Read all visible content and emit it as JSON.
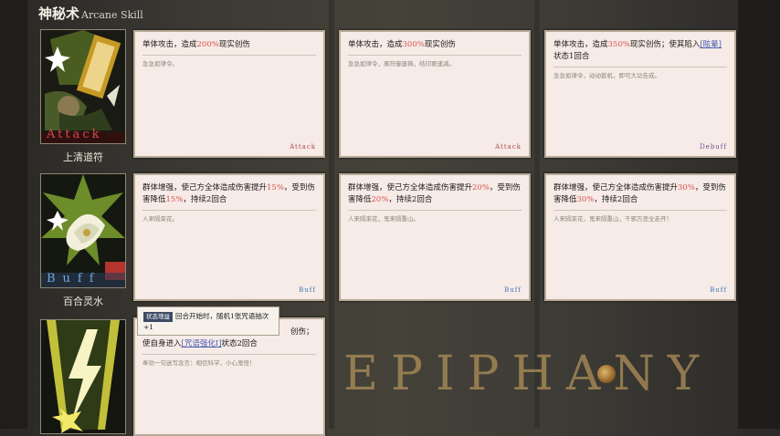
{
  "header": {
    "title_zh": "神秘术",
    "title_en": "Arcane Skill"
  },
  "background": {
    "logo_text": "EPIPHANY"
  },
  "skills": [
    {
      "name": "上清道符",
      "art_label": "Attack",
      "art_icon": "talisman-icon",
      "cards": [
        {
          "title_pre": "单体攻击，造成",
          "value": "200%",
          "title_post": "现实创伤",
          "flavor": "急急如律令。",
          "tag": "Attack"
        },
        {
          "title_pre": "单体攻击，造成",
          "value": "300%",
          "title_post": "现实创伤",
          "flavor": "急急如律令，离符御速祷，结印要速减。",
          "tag": "Attack"
        },
        {
          "title_pre": "单体攻击，造成",
          "value": "350%",
          "title_post": "现实创伤；使其陷入",
          "link": "[眩晕]",
          "title_tail": "状态1回合",
          "flavor": "急急如律令，动动扳机，即可大功告成。",
          "tag": "Debuff"
        }
      ]
    },
    {
      "name": "百合灵水",
      "art_label": "Buff",
      "art_icon": "lily-icon",
      "cards": [
        {
          "title_pre": "群体增强，使己方全体造成伤害提升",
          "value": "15%",
          "title_mid": "，受到伤害降低",
          "value2": "15%",
          "title_post": "，持续2回合",
          "flavor": "人来隔束花。",
          "tag": "Buff"
        },
        {
          "title_pre": "群体增强，使己方全体造成伤害提升",
          "value": "20%",
          "title_mid": "，受到伤害降低",
          "value2": "20%",
          "title_post": "，持续2回合",
          "flavor": "人来隔束花，鬼来隔重山。",
          "tag": "Buff"
        },
        {
          "title_pre": "群体增强，使己方全体造成伤害提升",
          "value": "30%",
          "title_mid": "，受到伤害降低",
          "value2": "30%",
          "title_post": "，持续2回合",
          "flavor": "人来隔束花，鬼来隔重山，千邪万恶全走开！",
          "tag": "Buff"
        }
      ]
    },
    {
      "name": "",
      "art_label": "",
      "art_icon": "lightning-icon",
      "cards": [
        {
          "title_pre": "",
          "title_post": "创伤；",
          "title_line2_pre": "使自身进入",
          "link": "[咒语强化Ⅰ]",
          "title_tail": "状态2回合",
          "flavor": "奉劝一句迷写念言：相信科学，小心鬼怪！",
          "tag": ""
        }
      ]
    }
  ],
  "tooltip": {
    "badge": "状态增益",
    "text": "回合开始时，随机1张咒语抽次+1"
  }
}
